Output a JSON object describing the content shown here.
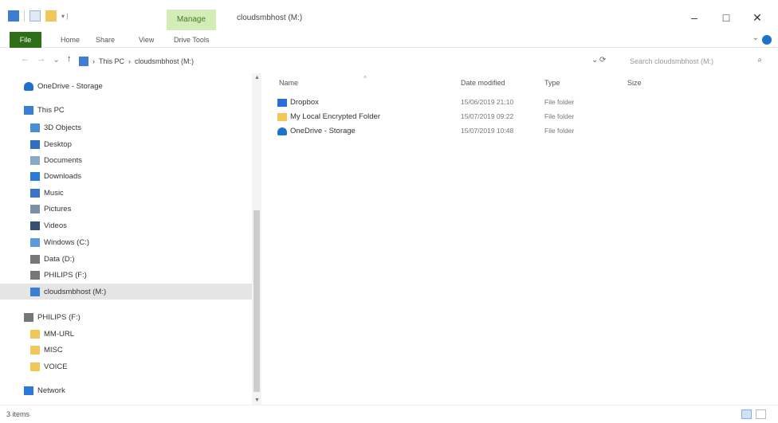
{
  "window": {
    "title": "cloudsmbhost (M:)",
    "manage_tab": "Manage",
    "controls": {
      "minimize": "–",
      "maximize": "□",
      "close": "✕"
    }
  },
  "ribbon": {
    "tabs": [
      "File",
      "Home",
      "Share",
      "View",
      "Drive Tools"
    ]
  },
  "address": {
    "back": "←",
    "forward": "→",
    "up": "↑",
    "path": [
      "This PC",
      "cloudsmbhost (M:)"
    ],
    "separator": "›",
    "refresh": "⟳",
    "search_placeholder": "Search cloudsmbhost (M:)",
    "search_icon": "search-icon"
  },
  "nav": {
    "items": [
      {
        "label": "OneDrive - Storage",
        "icon": "cloud-icon",
        "color": "#1e73c8",
        "indent": 0,
        "selected": false
      },
      {
        "label": "This PC",
        "icon": "computer-icon",
        "color": "#3c7fd2",
        "indent": 0,
        "selected": false
      },
      {
        "label": "3D Objects",
        "icon": "cube-icon",
        "color": "#4a8fd6",
        "indent": 1,
        "selected": false
      },
      {
        "label": "Desktop",
        "icon": "desktop-icon",
        "color": "#2f6fc0",
        "indent": 1,
        "selected": false
      },
      {
        "label": "Documents",
        "icon": "document-icon",
        "color": "#8aa9c9",
        "indent": 1,
        "selected": false
      },
      {
        "label": "Downloads",
        "icon": "download-icon",
        "color": "#2b7bd6",
        "indent": 1,
        "selected": false
      },
      {
        "label": "Music",
        "icon": "music-icon",
        "color": "#3a74c4",
        "indent": 1,
        "selected": false
      },
      {
        "label": "Pictures",
        "icon": "picture-icon",
        "color": "#7b8fa6",
        "indent": 1,
        "selected": false
      },
      {
        "label": "Videos",
        "icon": "video-icon",
        "color": "#35506e",
        "indent": 1,
        "selected": false
      },
      {
        "label": "Windows (C:)",
        "icon": "drive-icon",
        "color": "#5a9bd8",
        "indent": 1,
        "selected": false
      },
      {
        "label": "Data (D:)",
        "icon": "drive-icon",
        "color": "#777777",
        "indent": 1,
        "selected": false
      },
      {
        "label": "PHILIPS (F:)",
        "icon": "drive-icon",
        "color": "#777777",
        "indent": 1,
        "selected": false
      },
      {
        "label": "cloudsmbhost (M:)",
        "icon": "network-drive-icon",
        "color": "#3c7fd2",
        "indent": 1,
        "selected": true
      },
      {
        "label": "PHILIPS (F:)",
        "icon": "drive-icon",
        "color": "#777777",
        "indent": 0,
        "selected": false
      },
      {
        "label": "MM-URL",
        "icon": "folder-icon",
        "color": "#f1c75a",
        "indent": 1,
        "selected": false
      },
      {
        "label": "MISC",
        "icon": "folder-icon",
        "color": "#f1c75a",
        "indent": 1,
        "selected": false
      },
      {
        "label": "VOICE",
        "icon": "folder-icon",
        "color": "#f1c75a",
        "indent": 1,
        "selected": false
      },
      {
        "label": "Network",
        "icon": "network-icon",
        "color": "#2b7bd6",
        "indent": 0,
        "selected": false
      }
    ]
  },
  "content": {
    "columns": {
      "name": "Name",
      "date": "Date modified",
      "type": "Type",
      "size": "Size",
      "sort_caret": "^"
    },
    "rows": [
      {
        "name": "Dropbox",
        "date": "15/06/2019 21:10",
        "type": "File folder",
        "icon": "dropbox-icon",
        "color": "#2b6fd6"
      },
      {
        "name": "My Local Encrypted Folder",
        "date": "15/07/2019 09:22",
        "type": "File folder",
        "icon": "folder-icon",
        "color": "#f1c75a"
      },
      {
        "name": "OneDrive - Storage",
        "date": "15/07/2019 10:48",
        "type": "File folder",
        "icon": "cloud-icon",
        "color": "#1e73c8"
      }
    ]
  },
  "status": {
    "text": "3 items"
  }
}
